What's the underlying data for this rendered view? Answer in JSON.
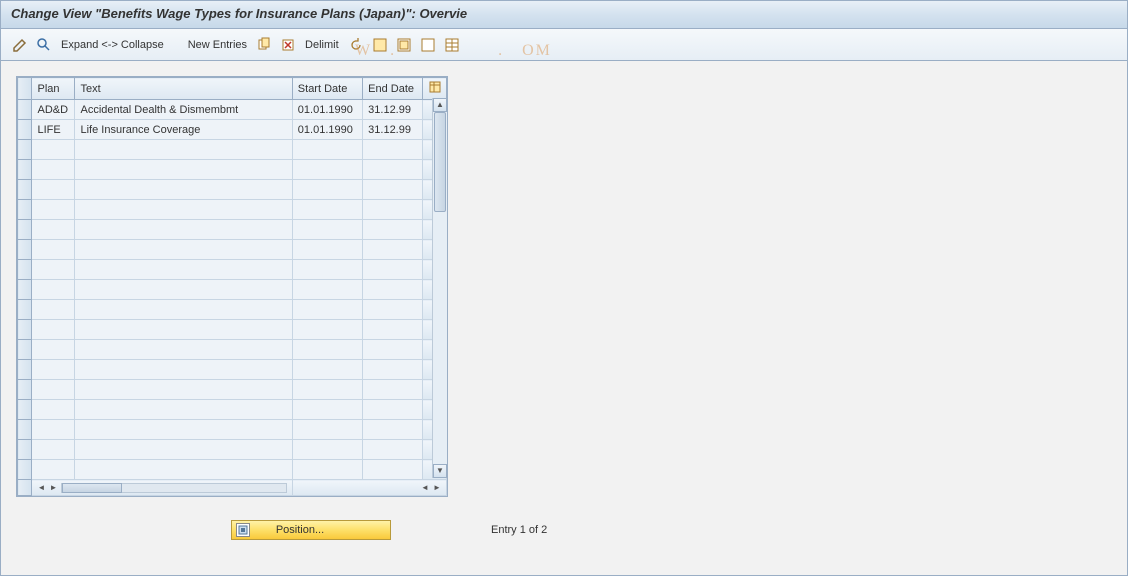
{
  "title": "Change View \"Benefits Wage Types for Insurance Plans (Japan)\": Overvie",
  "toolbar": {
    "expand": "Expand <-> Collapse",
    "new_entries": "New Entries",
    "delimit": "Delimit"
  },
  "columns": {
    "plan": "Plan",
    "text": "Text",
    "start": "Start Date",
    "end": "End Date"
  },
  "rows": [
    {
      "plan": "AD&D",
      "text": "Accidental Dealth & Dismembmt",
      "start": "01.01.1990",
      "end": "31.12.99"
    },
    {
      "plan": "LIFE",
      "text": "Life Insurance Coverage",
      "start": "01.01.1990",
      "end": "31.12.99"
    }
  ],
  "empty_row_count": 17,
  "footer": {
    "position": "Position...",
    "entry_text": "Entry 1 of 2"
  },
  "watermark": "W   .                 .   OM"
}
